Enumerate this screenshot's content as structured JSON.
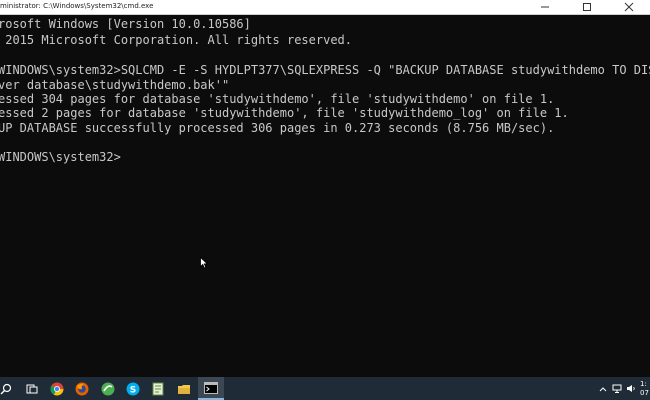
{
  "window": {
    "title": "ministrator: C:\\Windows\\System32\\cmd.exe"
  },
  "console": {
    "lines": [
      "rosoft Windows [Version 10.0.10586]",
      " 2015 Microsoft Corporation. All rights reserved.",
      "",
      "WINDOWS\\system32>SQLCMD -E -S HYDLPT377\\SQLEXPRESS -Q \"BACKUP DATABASE studywithdemo TO DISK='E:\\",
      "ver database\\studywithdemo.bak'\"",
      "essed 304 pages for database 'studywithdemo', file 'studywithdemo' on file 1.",
      "essed 2 pages for database 'studywithdemo', file 'studywithdemo_log' on file 1.",
      "UP DATABASE successfully processed 306 pages in 0.273 seconds (8.756 MB/sec).",
      "",
      "WINDOWS\\system32>"
    ]
  },
  "taskbar": {
    "items": [
      {
        "name": "search-icon"
      },
      {
        "name": "task-view-icon"
      },
      {
        "name": "chrome-icon"
      },
      {
        "name": "firefox-icon"
      },
      {
        "name": "browser-icon"
      },
      {
        "name": "skype-icon"
      },
      {
        "name": "notepad-icon"
      },
      {
        "name": "file-explorer-icon"
      },
      {
        "name": "cmd-icon"
      }
    ],
    "clock_time": "1:",
    "clock_date": "07"
  },
  "colors": {
    "console_bg": "#0c0c0c",
    "console_text": "#c8c8c8",
    "taskbar_bg": "#1f2b36"
  }
}
